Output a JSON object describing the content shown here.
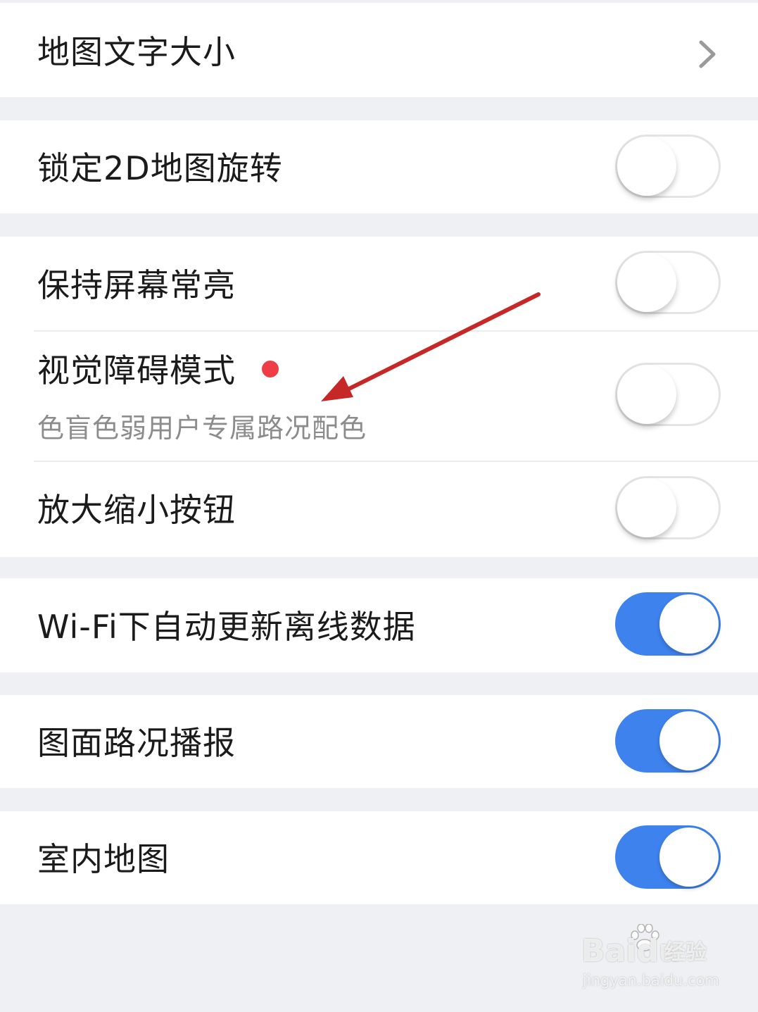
{
  "settings": {
    "map_text_size": {
      "label": "地图文字大小",
      "icon": "chevron-right-icon"
    },
    "lock_2d_rotation": {
      "label": "锁定2D地图旋转",
      "enabled": false
    },
    "keep_screen_on": {
      "label": "保持屏幕常亮",
      "enabled": false
    },
    "visual_impairment_mode": {
      "label": "视觉障碍模式",
      "sublabel": "色盲色弱用户专属路况配色",
      "enabled": false,
      "badge": "red-dot"
    },
    "zoom_buttons": {
      "label": "放大缩小按钮",
      "enabled": false
    },
    "wifi_auto_update": {
      "label": "Wi-Fi下自动更新离线数据",
      "enabled": true
    },
    "traffic_broadcast": {
      "label": "图面路况播报",
      "enabled": true
    },
    "indoor_map": {
      "label": "室内地图",
      "enabled": true
    }
  },
  "watermark": {
    "brand": "Bai",
    "brand_suffix": "du",
    "product": "经验",
    "url": "jingyan.baidu.com"
  },
  "colors": {
    "toggle_on": "#3e82ee",
    "badge_dot": "#ef3d48",
    "annotation_arrow": "#c62828",
    "page_background": "#eef0f3"
  }
}
